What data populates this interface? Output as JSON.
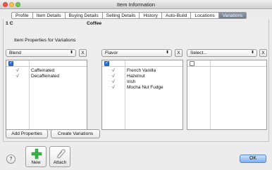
{
  "window": {
    "title": "Item Information"
  },
  "tabs": [
    "Profile",
    "Item Details",
    "Buying Details",
    "Selling Details",
    "History",
    "Auto-Build",
    "Locations",
    "Variations"
  ],
  "active_tab": "Variations",
  "header": {
    "item_code": "1 C",
    "item_name": "Coffee"
  },
  "section_label": "Item Properties for Variations",
  "columns": [
    {
      "select_value": "Blend",
      "header_checked": true,
      "values": [
        "Caffeinated",
        "Decaffeinated"
      ]
    },
    {
      "select_value": "Flavor",
      "header_checked": true,
      "values": [
        "French Vanilla",
        "Hazelnut",
        "Irish",
        "Mocha Nut Fudge"
      ]
    },
    {
      "select_value": "Select...",
      "header_checked": false,
      "values": []
    }
  ],
  "remove_label": "X",
  "check_mark": "√",
  "buttons": {
    "add_properties": "Add Properties",
    "create_variations": "Create Variations",
    "new": "New",
    "attach": "Attach",
    "ok": "OK",
    "help": "?"
  },
  "colors": {
    "accent": "#7fb0ee",
    "active_tab": "#7a8596",
    "new_icon": "#3bb34a"
  },
  "icons": {
    "new": "green-plus-icon",
    "attach": "paperclip-icon"
  }
}
